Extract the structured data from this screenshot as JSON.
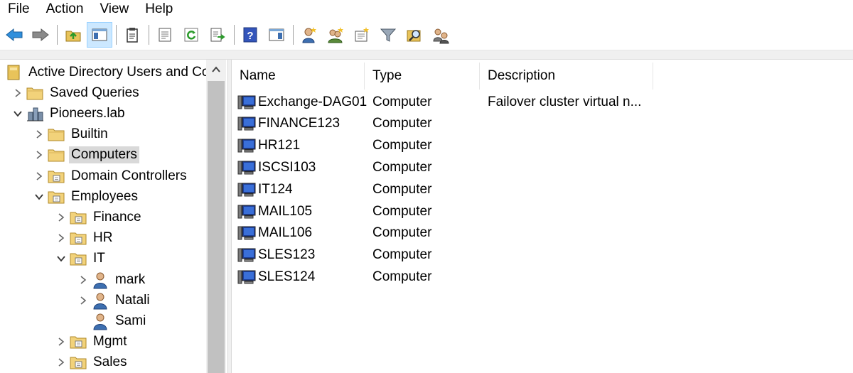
{
  "menubar": {
    "items": [
      "File",
      "Action",
      "View",
      "Help"
    ]
  },
  "toolbar": {
    "buttons": [
      "back-arrow-icon",
      "forward-arrow-icon",
      "up-folder-icon",
      "show-hide-tree-icon",
      "clipboard-icon",
      "properties-icon",
      "refresh-icon",
      "export-list-icon",
      "help-icon",
      "console-view-icon",
      "new-user-icon",
      "new-group-icon",
      "new-ou-icon",
      "filter-icon",
      "find-icon",
      "delegate-icon"
    ]
  },
  "tree": {
    "items": [
      {
        "label": "Active Directory Users and Co",
        "level": 0,
        "expander": "",
        "icon": "ad-root"
      },
      {
        "label": "Saved Queries",
        "level": 1,
        "expander": "collapsed",
        "icon": "folder"
      },
      {
        "label": "Pioneers.lab",
        "level": 1,
        "expander": "expanded",
        "icon": "domain"
      },
      {
        "label": "Builtin",
        "level": 2,
        "expander": "collapsed",
        "icon": "folder"
      },
      {
        "label": "Computers",
        "level": 2,
        "expander": "collapsed",
        "icon": "folder",
        "selected": true
      },
      {
        "label": "Domain Controllers",
        "level": 2,
        "expander": "collapsed",
        "icon": "ou"
      },
      {
        "label": "Employees",
        "level": 2,
        "expander": "expanded",
        "icon": "ou"
      },
      {
        "label": "Finance",
        "level": 3,
        "expander": "collapsed",
        "icon": "ou"
      },
      {
        "label": "HR",
        "level": 3,
        "expander": "collapsed",
        "icon": "ou"
      },
      {
        "label": "IT",
        "level": 3,
        "expander": "expanded",
        "icon": "ou"
      },
      {
        "label": "mark",
        "level": 4,
        "expander": "collapsed",
        "icon": "user"
      },
      {
        "label": "Natali",
        "level": 4,
        "expander": "collapsed",
        "icon": "user"
      },
      {
        "label": "Sami",
        "level": 4,
        "expander": "",
        "icon": "user"
      },
      {
        "label": "Mgmt",
        "level": 3,
        "expander": "collapsed",
        "icon": "ou"
      },
      {
        "label": "Sales",
        "level": 3,
        "expander": "collapsed",
        "icon": "ou"
      }
    ]
  },
  "list": {
    "columns": [
      "Name",
      "Type",
      "Description"
    ],
    "rows": [
      {
        "name": "Exchange-DAG01",
        "type": "Computer",
        "description": "Failover cluster virtual n..."
      },
      {
        "name": "FINANCE123",
        "type": "Computer",
        "description": ""
      },
      {
        "name": "HR121",
        "type": "Computer",
        "description": ""
      },
      {
        "name": "ISCSI103",
        "type": "Computer",
        "description": ""
      },
      {
        "name": "IT124",
        "type": "Computer",
        "description": ""
      },
      {
        "name": "MAIL105",
        "type": "Computer",
        "description": ""
      },
      {
        "name": "MAIL106",
        "type": "Computer",
        "description": ""
      },
      {
        "name": "SLES123",
        "type": "Computer",
        "description": ""
      },
      {
        "name": "SLES124",
        "type": "Computer",
        "description": ""
      }
    ]
  }
}
